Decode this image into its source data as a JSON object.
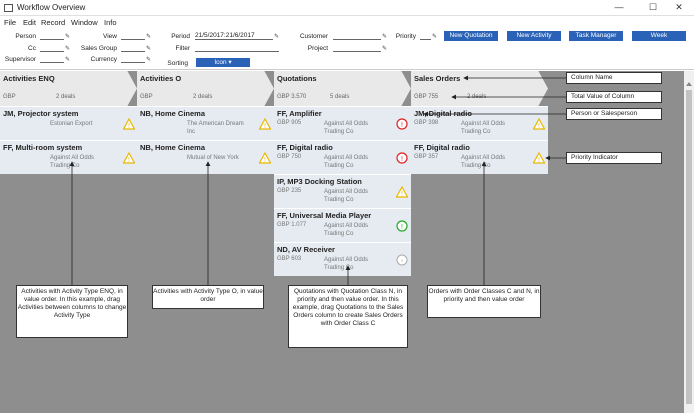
{
  "window": {
    "title": "Workflow Overview"
  },
  "menu": [
    "File",
    "Edit",
    "Record",
    "Window",
    "Info"
  ],
  "filters": {
    "person": "Person",
    "cc": "Cc",
    "supervisor": "Supervisor",
    "view": "View",
    "sales_group": "Sales Group",
    "currency": "Currency",
    "period": "Period",
    "period_value": "21/5/2017:21/6/2017",
    "filter": "Filter",
    "sorting": "Sorting",
    "customer": "Customer",
    "project": "Project",
    "priority": "Priority"
  },
  "toolbar": {
    "new_quotation": "New Quotation",
    "new_activity": "New Activity",
    "task_manager": "Task Manager",
    "week": "Week",
    "sort_value": "Icon"
  },
  "columns": [
    {
      "name": "Activities ENQ",
      "total": "GBP",
      "count": "2 deals"
    },
    {
      "name": "Activities O",
      "total": "GBP",
      "count": "2 deals"
    },
    {
      "name": "Quotations",
      "total": "GBP 3.570",
      "count": "5 deals"
    },
    {
      "name": "Sales Orders",
      "total": "GBP 755",
      "count": "2 deals"
    }
  ],
  "cards": {
    "enq": [
      {
        "title": "JM, Projector system",
        "amount": "",
        "customer": "Estonian Export",
        "priority": "warning"
      },
      {
        "title": "FF, Multi-room system",
        "amount": "",
        "customer": "Against All Odds Trading Co",
        "priority": "warning"
      }
    ],
    "o": [
      {
        "title": "NB, Home Cinema",
        "amount": "",
        "customer": "The American Dream Inc",
        "priority": "warning"
      },
      {
        "title": "NB, Home Cinema",
        "amount": "",
        "customer": "Mutual of New York",
        "priority": "warning"
      }
    ],
    "quot": [
      {
        "title": "FF, Amplifier",
        "amount": "GBP 905",
        "customer": "Against All Odds Trading Co",
        "priority": "stop"
      },
      {
        "title": "FF, Digital radio",
        "amount": "GBP 750",
        "customer": "Against All Odds Trading Co",
        "priority": "stop"
      },
      {
        "title": "IP, MP3 Docking Station",
        "amount": "GBP 235",
        "customer": "Against All Odds Trading Co",
        "priority": "warning"
      },
      {
        "title": "FF, Universal Media Player",
        "amount": "GBP 1.077",
        "customer": "Against All Odds Trading Co",
        "priority": "ok"
      },
      {
        "title": "ND, AV Receiver",
        "amount": "GBP 603",
        "customer": "Against All Odds Trading Co",
        "priority": "low"
      }
    ],
    "so": [
      {
        "title": "JM, Digital radio",
        "amount": "GBP 398",
        "customer": "Against All Odds Trading Co",
        "priority": "warning"
      },
      {
        "title": "FF, Digital radio",
        "amount": "GBP 357",
        "customer": "Against All Odds Trading Co",
        "priority": "warning"
      }
    ]
  },
  "annotations": {
    "column_name": "Column Name",
    "total_value": "Total Value of Column",
    "person": "Person or Salesperson",
    "priority": "Priority Indicator",
    "enq": "Activities with Activity Type ENQ, in value order. In this example, drag Activities between columns to change Activity Type",
    "o": "Activities with Activity Type O, in value order",
    "quot": "Quotations with Quotation Class N, in priority and then value order. In this example, drag Quotations to the Sales Orders column to create Sales Orders with Order Class C",
    "so": "Orders with Order Classes C and N, in priority and then value order"
  }
}
